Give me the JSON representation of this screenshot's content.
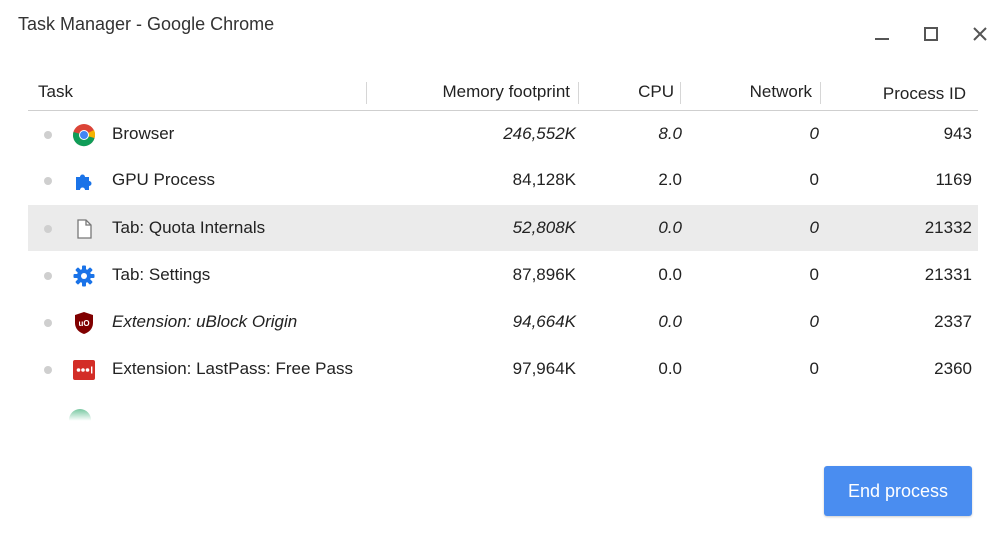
{
  "window": {
    "title": "Task Manager - Google Chrome"
  },
  "table": {
    "headers": {
      "task": "Task",
      "memory": "Memory footprint",
      "cpu": "CPU",
      "network": "Network",
      "pid": "Process ID"
    },
    "rows": [
      {
        "name": "Browser",
        "icon": "chrome-icon",
        "memory": "246,552K",
        "cpu": "8.0",
        "network": "0",
        "pid": "943",
        "italic": true,
        "selected": false
      },
      {
        "name": "GPU Process",
        "icon": "puzzle-icon",
        "memory": "84,128K",
        "cpu": "2.0",
        "network": "0",
        "pid": "1169",
        "italic": false,
        "selected": false
      },
      {
        "name": "Tab: Quota Internals",
        "icon": "page-icon",
        "memory": "52,808K",
        "cpu": "0.0",
        "network": "0",
        "pid": "21332",
        "italic": true,
        "selected": true
      },
      {
        "name": "Tab: Settings",
        "icon": "gear-icon",
        "memory": "87,896K",
        "cpu": "0.0",
        "network": "0",
        "pid": "21331",
        "italic": false,
        "selected": false
      },
      {
        "name": "Extension: uBlock Origin",
        "icon": "ublock-icon",
        "memory": "94,664K",
        "cpu": "0.0",
        "network": "0",
        "pid": "2337",
        "italic": true,
        "selected": false
      },
      {
        "name": "Extension: LastPass: Free Pass",
        "icon": "lastpass-icon",
        "memory": "97,964K",
        "cpu": "0.0",
        "network": "0",
        "pid": "2360",
        "italic": false,
        "selected": false
      }
    ]
  },
  "actions": {
    "end_process": "End process"
  },
  "colors": {
    "accent": "#4a8df0",
    "selected_row": "#ebebeb"
  }
}
